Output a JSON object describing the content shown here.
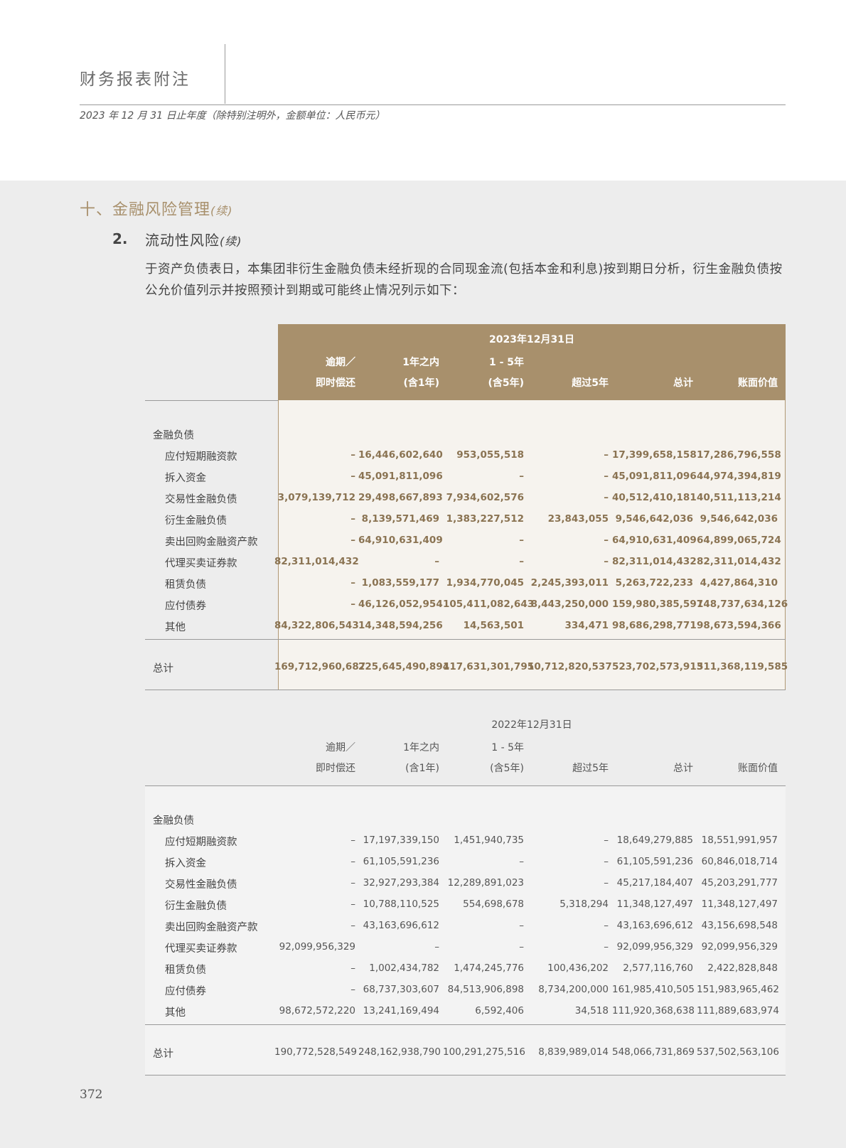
{
  "header": {
    "title": "财务报表附注",
    "subtitle": "2023 年 12 月 31 日止年度（除特别注明外，金额单位：人民币元）"
  },
  "section": {
    "title": "十、金融风险管理",
    "cont": "(续)",
    "sub_number": "2.",
    "sub_title": "流动性风险",
    "sub_cont": "(续)",
    "paragraph": "于资产负债表日，本集团非衍生金融负债未经折现的合同现金流(包括本金和利息)按到期日分析，衍生金融负债按公允价值列示并按照预计到期或可能终止情况列示如下："
  },
  "columns": [
    {
      "line1": "逾期／",
      "line2": "即时偿还"
    },
    {
      "line1": "1年之内",
      "line2": "(含1年)"
    },
    {
      "line1": "1 - 5年",
      "line2": "(含5年)"
    },
    {
      "line1": "",
      "line2": "超过5年"
    },
    {
      "line1": "",
      "line2": "总计"
    },
    {
      "line1": "",
      "line2": "账面价值"
    }
  ],
  "tables": [
    {
      "year": "2023年12月31日",
      "group_label": "金融负债",
      "rows": [
        {
          "label": "应付短期融资款",
          "values": [
            "–",
            "16,446,602,640",
            "953,055,518",
            "–",
            "17,399,658,158",
            "17,286,796,558"
          ]
        },
        {
          "label": "拆入资金",
          "values": [
            "–",
            "45,091,811,096",
            "–",
            "–",
            "45,091,811,096",
            "44,974,394,819"
          ]
        },
        {
          "label": "交易性金融负债",
          "values": [
            "3,079,139,712",
            "29,498,667,893",
            "7,934,602,576",
            "–",
            "40,512,410,181",
            "40,511,113,214"
          ]
        },
        {
          "label": "衍生金融负债",
          "values": [
            "–",
            "8,139,571,469",
            "1,383,227,512",
            "23,843,055",
            "9,546,642,036",
            "9,546,642,036"
          ]
        },
        {
          "label": "卖出回购金融资产款",
          "values": [
            "–",
            "64,910,631,409",
            "–",
            "–",
            "64,910,631,409",
            "64,899,065,724"
          ]
        },
        {
          "label": "代理买卖证券款",
          "values": [
            "82,311,014,432",
            "–",
            "–",
            "–",
            "82,311,014,432",
            "82,311,014,432"
          ]
        },
        {
          "label": "租赁负债",
          "values": [
            "–",
            "1,083,559,177",
            "1,934,770,045",
            "2,245,393,011",
            "5,263,722,233",
            "4,427,864,310"
          ]
        },
        {
          "label": "应付债券",
          "values": [
            "–",
            "46,126,052,954",
            "105,411,082,643",
            "8,443,250,000",
            "159,980,385,597",
            "148,737,634,126"
          ]
        },
        {
          "label": "其他",
          "values": [
            "84,322,806,543",
            "14,348,594,256",
            "14,563,501",
            "334,471",
            "98,686,298,771",
            "98,673,594,366"
          ]
        }
      ],
      "total": {
        "label": "总计",
        "values": [
          "169,712,960,687",
          "225,645,490,894",
          "117,631,301,795",
          "10,712,820,537",
          "523,702,573,913",
          "511,368,119,585"
        ]
      }
    },
    {
      "year": "2022年12月31日",
      "group_label": "金融负债",
      "rows": [
        {
          "label": "应付短期融资款",
          "values": [
            "–",
            "17,197,339,150",
            "1,451,940,735",
            "–",
            "18,649,279,885",
            "18,551,991,957"
          ]
        },
        {
          "label": "拆入资金",
          "values": [
            "–",
            "61,105,591,236",
            "–",
            "–",
            "61,105,591,236",
            "60,846,018,714"
          ]
        },
        {
          "label": "交易性金融负债",
          "values": [
            "–",
            "32,927,293,384",
            "12,289,891,023",
            "–",
            "45,217,184,407",
            "45,203,291,777"
          ]
        },
        {
          "label": "衍生金融负债",
          "values": [
            "–",
            "10,788,110,525",
            "554,698,678",
            "5,318,294",
            "11,348,127,497",
            "11,348,127,497"
          ]
        },
        {
          "label": "卖出回购金融资产款",
          "values": [
            "–",
            "43,163,696,612",
            "–",
            "–",
            "43,163,696,612",
            "43,156,698,548"
          ]
        },
        {
          "label": "代理买卖证券款",
          "values": [
            "92,099,956,329",
            "–",
            "–",
            "–",
            "92,099,956,329",
            "92,099,956,329"
          ]
        },
        {
          "label": "租赁负债",
          "values": [
            "–",
            "1,002,434,782",
            "1,474,245,776",
            "100,436,202",
            "2,577,116,760",
            "2,422,828,848"
          ]
        },
        {
          "label": "应付债券",
          "values": [
            "–",
            "68,737,303,607",
            "84,513,906,898",
            "8,734,200,000",
            "161,985,410,505",
            "151,983,965,462"
          ]
        },
        {
          "label": "其他",
          "values": [
            "98,672,572,220",
            "13,241,169,494",
            "6,592,406",
            "34,518",
            "111,920,368,638",
            "111,889,683,974"
          ]
        }
      ],
      "total": {
        "label": "总计",
        "values": [
          "190,772,528,549",
          "248,162,938,790",
          "100,291,275,516",
          "8,839,989,014",
          "548,066,731,869",
          "537,502,563,106"
        ]
      }
    }
  ],
  "page_number": "372",
  "colors": {
    "accent": "#a8906c",
    "accent_text": "#8a7352",
    "gray_background": "#ededed"
  }
}
